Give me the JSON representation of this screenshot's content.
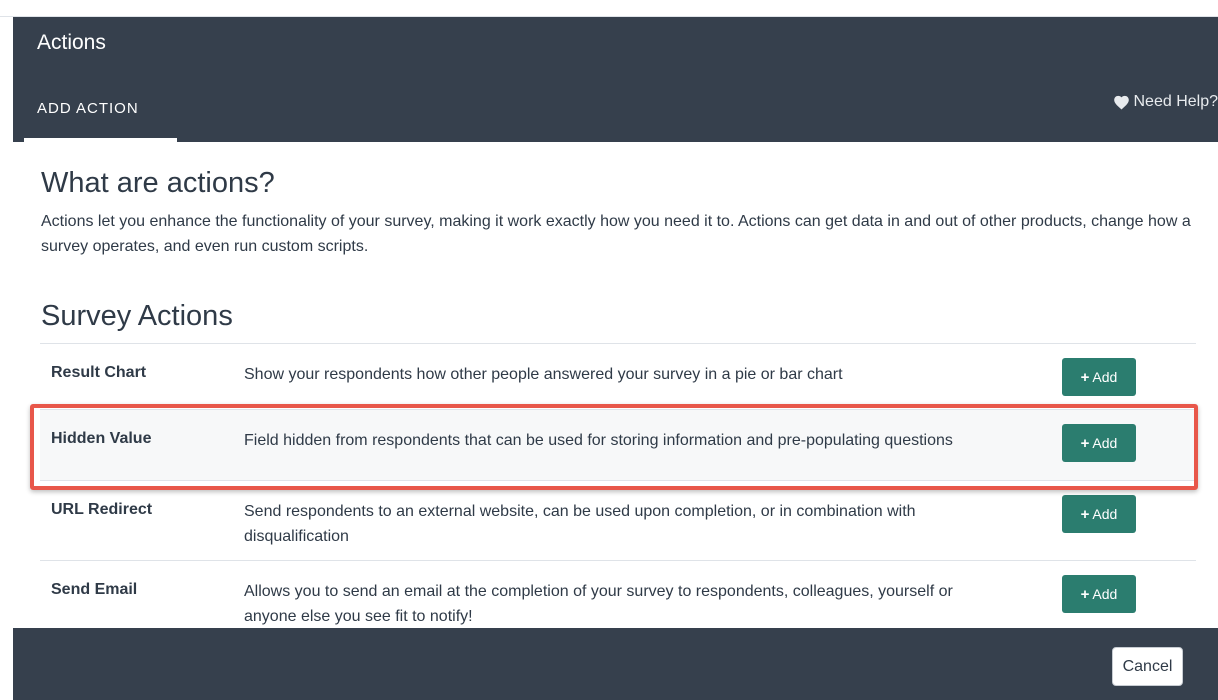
{
  "header": {
    "title": "Actions",
    "tab_label": "ADD ACTION",
    "help_label": "Need Help?"
  },
  "intro": {
    "heading": "What are actions?",
    "text": "Actions let you enhance the functionality of your survey, making it work exactly how you need it to. Actions can get data in and out of other products, change how a survey operates, and even run custom scripts."
  },
  "survey_actions": {
    "heading": "Survey Actions",
    "add_label": "Add",
    "rows": [
      {
        "name": "Result Chart",
        "description": "Show your respondents how other people answered your survey in a pie or bar chart"
      },
      {
        "name": "Hidden Value",
        "description": "Field hidden from respondents that can be used for storing information and pre-populating questions"
      },
      {
        "name": "URL Redirect",
        "description": "Send respondents to an external website, can be used upon completion, or in combination with disqualification"
      },
      {
        "name": "Send Email",
        "description": "Allows you to send an email at the completion of your survey to respondents, colleagues, yourself or anyone else you see fit to notify!"
      }
    ]
  },
  "footer": {
    "cancel_label": "Cancel"
  },
  "colors": {
    "header_bg": "#36404d",
    "add_button": "#2b7d6f",
    "highlight": "#e8574a"
  },
  "icons": {
    "help": "heart-icon",
    "add": "plus-icon"
  }
}
